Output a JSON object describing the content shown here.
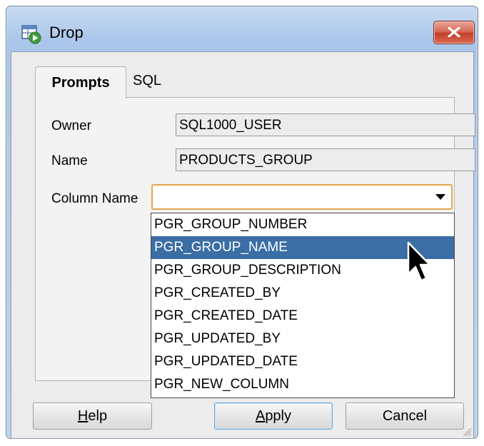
{
  "window": {
    "title": "Drop",
    "close_glyph": "✕"
  },
  "tabs": [
    {
      "label": "Prompts",
      "active": true
    },
    {
      "label": "SQL",
      "active": false
    }
  ],
  "form": {
    "owner": {
      "label": "Owner",
      "value": "SQL1000_USER"
    },
    "name": {
      "label": "Name",
      "value": "PRODUCTS_GROUP"
    },
    "column_name": {
      "label": "Column Name",
      "value": ""
    }
  },
  "dropdown": {
    "options": [
      "PGR_GROUP_NUMBER",
      "PGR_GROUP_NAME",
      "PGR_GROUP_DESCRIPTION",
      "PGR_CREATED_BY",
      "PGR_CREATED_DATE",
      "PGR_UPDATED_BY",
      "PGR_UPDATED_DATE",
      "PGR_NEW_COLUMN"
    ],
    "highlighted_index": 1
  },
  "buttons": {
    "help_mnemonic": "H",
    "help_rest": "elp",
    "apply_mnemonic": "A",
    "apply_rest": "pply",
    "cancel": "Cancel"
  },
  "colors": {
    "selection": "#3a6ea5",
    "focus_border": "#e3a64a",
    "close_red": "#c23e28"
  },
  "icons": {
    "app": "table-run-icon",
    "close": "close-icon",
    "dropdown": "chevron-down-icon",
    "cursor": "mouse-pointer-icon",
    "grip": "resize-grip-icon"
  }
}
